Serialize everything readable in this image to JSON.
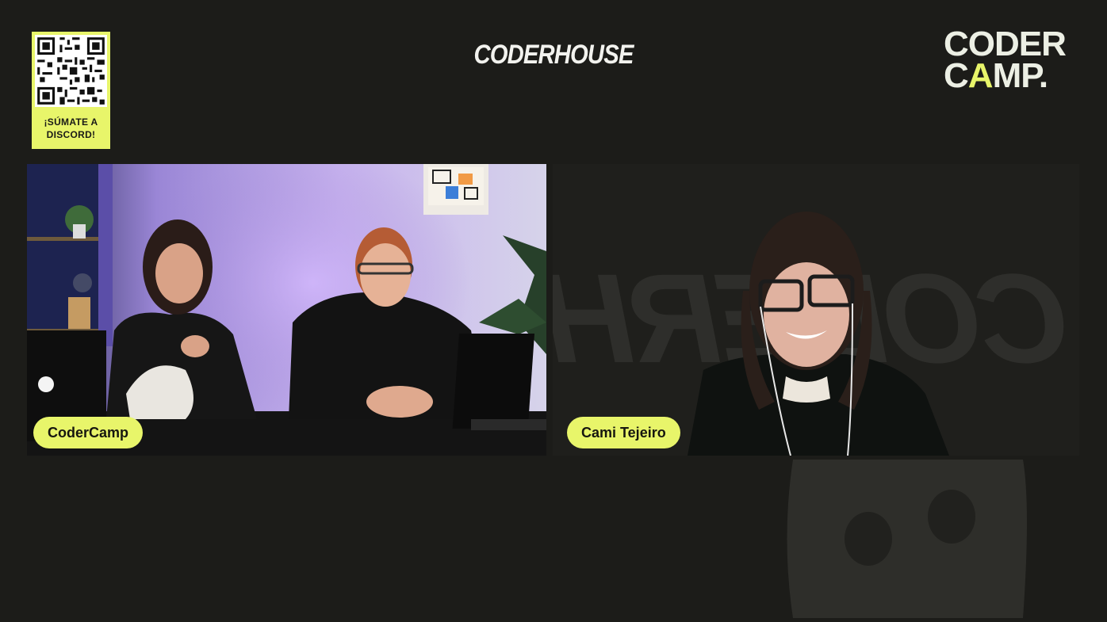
{
  "header": {
    "qr_label": "¡SÚMATE A\nDISCORD!",
    "center_brand": "CODERHOUSE",
    "right_brand_line1": "CODER",
    "right_brand_line2_a": "C",
    "right_brand_line2_b": "A",
    "right_brand_line2_c": "MP."
  },
  "participants": [
    {
      "name": "CoderCamp"
    },
    {
      "name": "Cami Tejeiro"
    }
  ],
  "colors": {
    "accent": "#e8f56a",
    "background": "#1c1c19"
  },
  "icons": {
    "discord_watermark": "discord-icon"
  }
}
